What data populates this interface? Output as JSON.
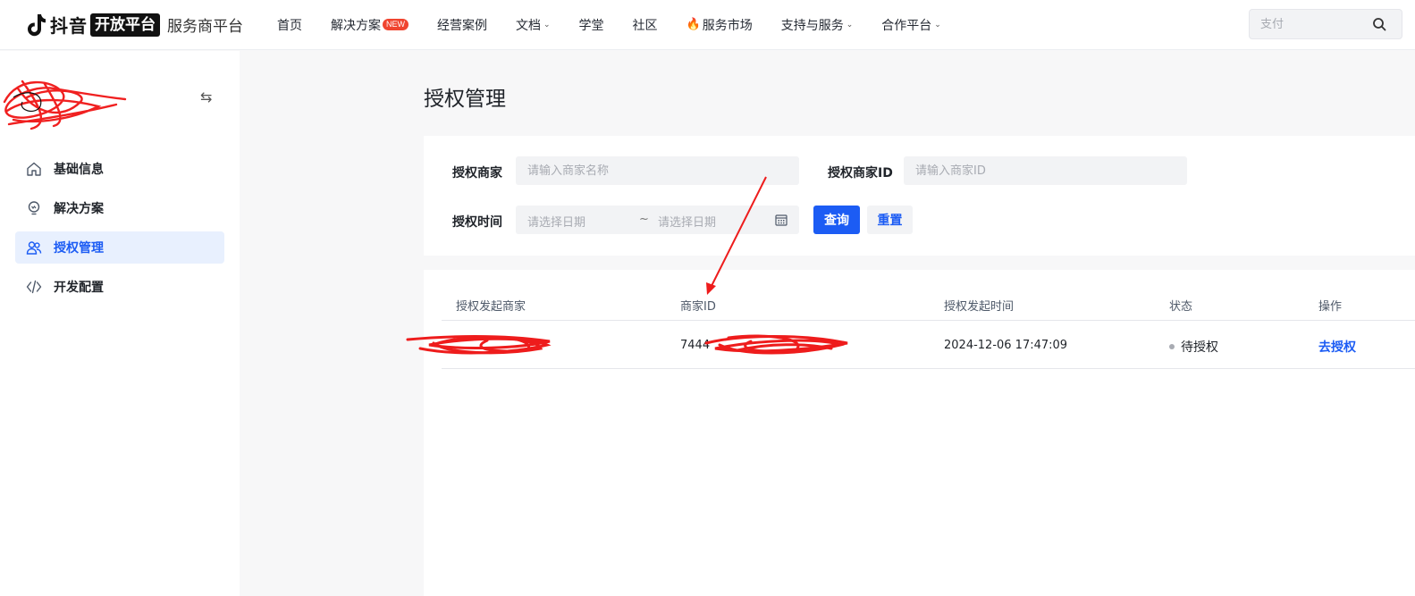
{
  "brand": {
    "name": "抖音",
    "badge": "开放平台",
    "sub": "服务商平台"
  },
  "nav": [
    {
      "label": "首页"
    },
    {
      "label": "解决方案",
      "badge": "NEW"
    },
    {
      "label": "经营案例"
    },
    {
      "label": "文档",
      "dropdown": true
    },
    {
      "label": "学堂"
    },
    {
      "label": "社区"
    },
    {
      "label": "服务市场",
      "icon": "fire-icon"
    },
    {
      "label": "支持与服务",
      "dropdown": true
    },
    {
      "label": "合作平台",
      "dropdown": true
    }
  ],
  "search": {
    "placeholder": "支付"
  },
  "sidebar": {
    "items": [
      {
        "label": "基础信息",
        "icon": "home-icon"
      },
      {
        "label": "解决方案",
        "icon": "bulb-icon"
      },
      {
        "label": "授权管理",
        "icon": "users-icon",
        "active": true
      },
      {
        "label": "开发配置",
        "icon": "code-icon"
      }
    ]
  },
  "page": {
    "title": "授权管理"
  },
  "filters": {
    "merchant_label": "授权商家",
    "merchant_placeholder": "请输入商家名称",
    "merchant_id_label": "授权商家ID",
    "merchant_id_placeholder": "请输入商家ID",
    "time_label": "授权时间",
    "date_start_placeholder": "请选择日期",
    "date_sep": "~",
    "date_end_placeholder": "请选择日期",
    "query_label": "查询",
    "reset_label": "重置"
  },
  "table": {
    "headers": [
      "授权发起商家",
      "商家ID",
      "授权发起时间",
      "状态",
      "操作"
    ],
    "rows": [
      {
        "merchant": "",
        "merchant_id": "7444",
        "time": "2024-12-06 17:47:09",
        "status": "待授权",
        "action": "去授权"
      }
    ]
  },
  "colors": {
    "accent": "#1c5cf4",
    "annotation": "#ee1c1c",
    "new_badge": "#f0442f"
  }
}
